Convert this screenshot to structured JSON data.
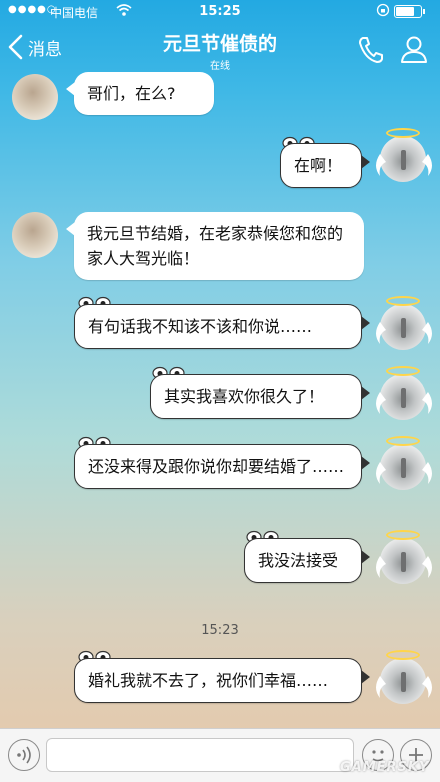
{
  "status_bar": {
    "signal": "●●●●○",
    "carrier": "中国电信",
    "time": "15:25",
    "battery_level": 0.8
  },
  "header": {
    "back_label": "消息",
    "title": "元旦节催债的",
    "status": "在线",
    "phone_icon": "phone-icon",
    "contact_icon": "contact-icon"
  },
  "messages": [
    {
      "side": "in",
      "text": "哥们，在么?"
    },
    {
      "side": "out",
      "text": "在啊！"
    },
    {
      "side": "in",
      "text": "我元旦节结婚，在老家恭候您和您的家人大驾光临！"
    },
    {
      "side": "out",
      "text": "有句话我不知该不该和你说……"
    },
    {
      "side": "out",
      "text": "其实我喜欢你很久了！"
    },
    {
      "side": "out",
      "text": "还没来得及跟你说你却要结婚了……"
    },
    {
      "side": "out",
      "text": "我没法接受"
    },
    {
      "side": "out",
      "text": "婚礼我就不去了，祝你们幸福……"
    }
  ],
  "timestamp": "15:23",
  "input_bar": {
    "voice_icon": "voice-icon",
    "emoji_icon": "emoji-icon",
    "plus_icon": "plus-icon",
    "text_value": ""
  },
  "watermark": "GAMERSKY",
  "colors": {
    "header_blue": "#23a9e2",
    "bubble_white": "#ffffff",
    "halo_gold": "#ffd54a"
  }
}
